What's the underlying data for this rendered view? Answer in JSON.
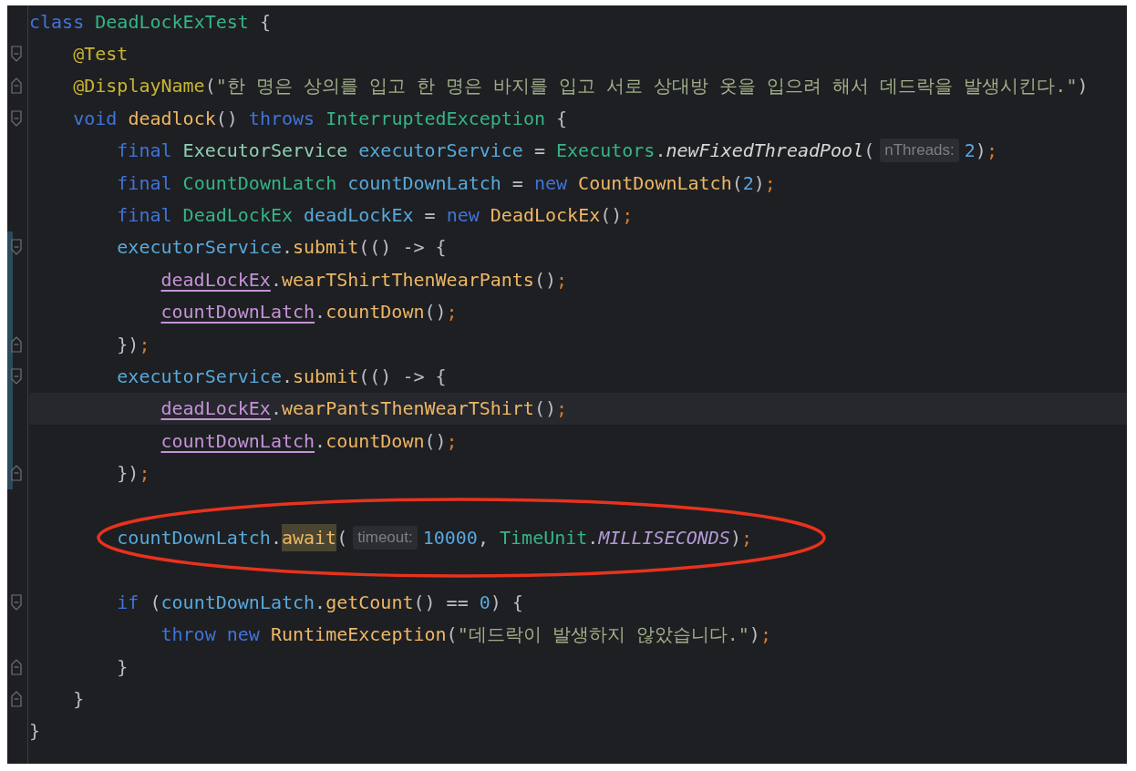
{
  "editor": {
    "lines": [
      {
        "tokens": [
          {
            "text": "class",
            "kind": "keyword"
          },
          {
            "text": " DeadLockExTest",
            "kind": "class"
          },
          {
            "text": " {",
            "kind": "punct"
          }
        ]
      },
      {
        "fold_start": true,
        "tokens": [
          {
            "text": "    @Test",
            "kind": "annotation"
          }
        ]
      },
      {
        "fold_end": true,
        "tokens": [
          {
            "text": "    @DisplayName",
            "kind": "annotation"
          },
          {
            "text": "(",
            "kind": "punct"
          },
          {
            "text": "\"한 명은 상의를 입고 한 명은 바지를 입고 서로 상대방 옷을 입으려 해서 데드락을 발생시킨다.\"",
            "kind": "string"
          },
          {
            "text": ")",
            "kind": "punct"
          }
        ]
      },
      {
        "fold_start": true,
        "tokens": [
          {
            "text": "    void",
            "kind": "keyword"
          },
          {
            "text": " deadlock",
            "kind": "method"
          },
          {
            "text": "() ",
            "kind": "punct"
          },
          {
            "text": "throws",
            "kind": "keyword"
          },
          {
            "text": " InterruptedException",
            "kind": "class"
          },
          {
            "text": " {",
            "kind": "punct"
          }
        ]
      },
      {
        "tokens": [
          {
            "text": "        final",
            "kind": "keyword"
          },
          {
            "text": " ExecutorService",
            "kind": "interface"
          },
          {
            "text": " executorService",
            "kind": "variable"
          },
          {
            "text": " = ",
            "kind": "punct"
          },
          {
            "text": "Executors",
            "kind": "class"
          },
          {
            "text": ".",
            "kind": "punct"
          },
          {
            "text": "newFixedThreadPool",
            "kind": "static_call"
          },
          {
            "text": "(",
            "kind": "punct"
          },
          {
            "text": "nThreads:",
            "kind": "hint"
          },
          {
            "text": "2",
            "kind": "number"
          },
          {
            "text": ")",
            "kind": "punct"
          },
          {
            "text": ";",
            "kind": "semicolon"
          }
        ]
      },
      {
        "tokens": [
          {
            "text": "        final",
            "kind": "keyword"
          },
          {
            "text": " CountDownLatch",
            "kind": "class"
          },
          {
            "text": " countDownLatch",
            "kind": "variable"
          },
          {
            "text": " = ",
            "kind": "punct"
          },
          {
            "text": "new",
            "kind": "keyword"
          },
          {
            "text": " CountDownLatch",
            "kind": "method"
          },
          {
            "text": "(",
            "kind": "punct"
          },
          {
            "text": "2",
            "kind": "number"
          },
          {
            "text": ")",
            "kind": "punct"
          },
          {
            "text": ";",
            "kind": "semicolon"
          }
        ]
      },
      {
        "tokens": [
          {
            "text": "        final",
            "kind": "keyword"
          },
          {
            "text": " DeadLockEx",
            "kind": "class"
          },
          {
            "text": " deadLockEx",
            "kind": "variable"
          },
          {
            "text": " = ",
            "kind": "punct"
          },
          {
            "text": "new",
            "kind": "keyword"
          },
          {
            "text": " DeadLockEx",
            "kind": "method"
          },
          {
            "text": "()",
            "kind": "punct"
          },
          {
            "text": ";",
            "kind": "semicolon"
          }
        ]
      },
      {
        "fold_start": true,
        "changed": true,
        "tokens": [
          {
            "text": "        executorService",
            "kind": "variable"
          },
          {
            "text": ".",
            "kind": "punct"
          },
          {
            "text": "submit",
            "kind": "method"
          },
          {
            "text": "(() -> {",
            "kind": "punct"
          }
        ]
      },
      {
        "changed": true,
        "tokens": [
          {
            "text": "            deadLockEx",
            "kind": "field"
          },
          {
            "text": ".",
            "kind": "punct"
          },
          {
            "text": "wearTShirtThenWearPants",
            "kind": "method"
          },
          {
            "text": "()",
            "kind": "punct"
          },
          {
            "text": ";",
            "kind": "semicolon"
          }
        ]
      },
      {
        "changed": true,
        "tokens": [
          {
            "text": "            countDownLatch",
            "kind": "field"
          },
          {
            "text": ".",
            "kind": "punct"
          },
          {
            "text": "countDown",
            "kind": "method"
          },
          {
            "text": "()",
            "kind": "punct"
          },
          {
            "text": ";",
            "kind": "semicolon"
          }
        ]
      },
      {
        "fold_end": true,
        "changed": true,
        "tokens": [
          {
            "text": "        })",
            "kind": "punct"
          },
          {
            "text": ";",
            "kind": "semicolon"
          }
        ]
      },
      {
        "fold_start": true,
        "changed": true,
        "tokens": [
          {
            "text": "        executorService",
            "kind": "variable"
          },
          {
            "text": ".",
            "kind": "punct"
          },
          {
            "text": "submit",
            "kind": "method"
          },
          {
            "text": "(() -> {",
            "kind": "punct"
          }
        ]
      },
      {
        "changed": true,
        "current": true,
        "tokens": [
          {
            "text": "            deadLockEx",
            "kind": "field"
          },
          {
            "text": ".",
            "kind": "punct"
          },
          {
            "text": "wearPantsThenWearTShirt",
            "kind": "method"
          },
          {
            "text": "()",
            "kind": "punct"
          },
          {
            "text": ";",
            "kind": "semicolon"
          }
        ]
      },
      {
        "changed": true,
        "tokens": [
          {
            "text": "            countDownLatch",
            "kind": "field"
          },
          {
            "text": ".",
            "kind": "punct"
          },
          {
            "text": "countDown",
            "kind": "method"
          },
          {
            "text": "()",
            "kind": "punct"
          },
          {
            "text": ";",
            "kind": "semicolon"
          }
        ]
      },
      {
        "fold_end": true,
        "changed": true,
        "tokens": [
          {
            "text": "        })",
            "kind": "punct"
          },
          {
            "text": ";",
            "kind": "semicolon"
          }
        ]
      },
      {
        "blank": true
      },
      {
        "circled": true,
        "tokens": [
          {
            "text": "        countDownLatch",
            "kind": "variable"
          },
          {
            "text": ".",
            "kind": "punct"
          },
          {
            "text": "await",
            "kind": "method",
            "highlighted": true
          },
          {
            "text": "(",
            "kind": "punct"
          },
          {
            "text": "timeout:",
            "kind": "hint"
          },
          {
            "text": "10000",
            "kind": "number"
          },
          {
            "text": ", ",
            "kind": "punct"
          },
          {
            "text": "TimeUnit",
            "kind": "class"
          },
          {
            "text": ".",
            "kind": "punct"
          },
          {
            "text": "MILLISECONDS",
            "kind": "constant"
          },
          {
            "text": ")",
            "kind": "punct"
          },
          {
            "text": ";",
            "kind": "semicolon"
          }
        ]
      },
      {
        "blank": true
      },
      {
        "fold_start": true,
        "tokens": [
          {
            "text": "        if",
            "kind": "keyword"
          },
          {
            "text": " (",
            "kind": "punct"
          },
          {
            "text": "countDownLatch",
            "kind": "variable"
          },
          {
            "text": ".",
            "kind": "punct"
          },
          {
            "text": "getCount",
            "kind": "method"
          },
          {
            "text": "() == ",
            "kind": "punct"
          },
          {
            "text": "0",
            "kind": "number"
          },
          {
            "text": ") {",
            "kind": "punct"
          }
        ]
      },
      {
        "tokens": [
          {
            "text": "            throw",
            "kind": "keyword"
          },
          {
            "text": " new",
            "kind": "keyword"
          },
          {
            "text": " RuntimeException",
            "kind": "method"
          },
          {
            "text": "(",
            "kind": "punct"
          },
          {
            "text": "\"데드락이 발생하지 않았습니다.\"",
            "kind": "string"
          },
          {
            "text": ")",
            "kind": "punct"
          },
          {
            "text": ";",
            "kind": "semicolon"
          }
        ]
      },
      {
        "fold_end": true,
        "tokens": [
          {
            "text": "        }",
            "kind": "punct"
          }
        ]
      },
      {
        "fold_end": true,
        "tokens": [
          {
            "text": "    }",
            "kind": "punct"
          }
        ]
      },
      {
        "tokens": [
          {
            "text": "}",
            "kind": "punct"
          }
        ]
      }
    ]
  }
}
